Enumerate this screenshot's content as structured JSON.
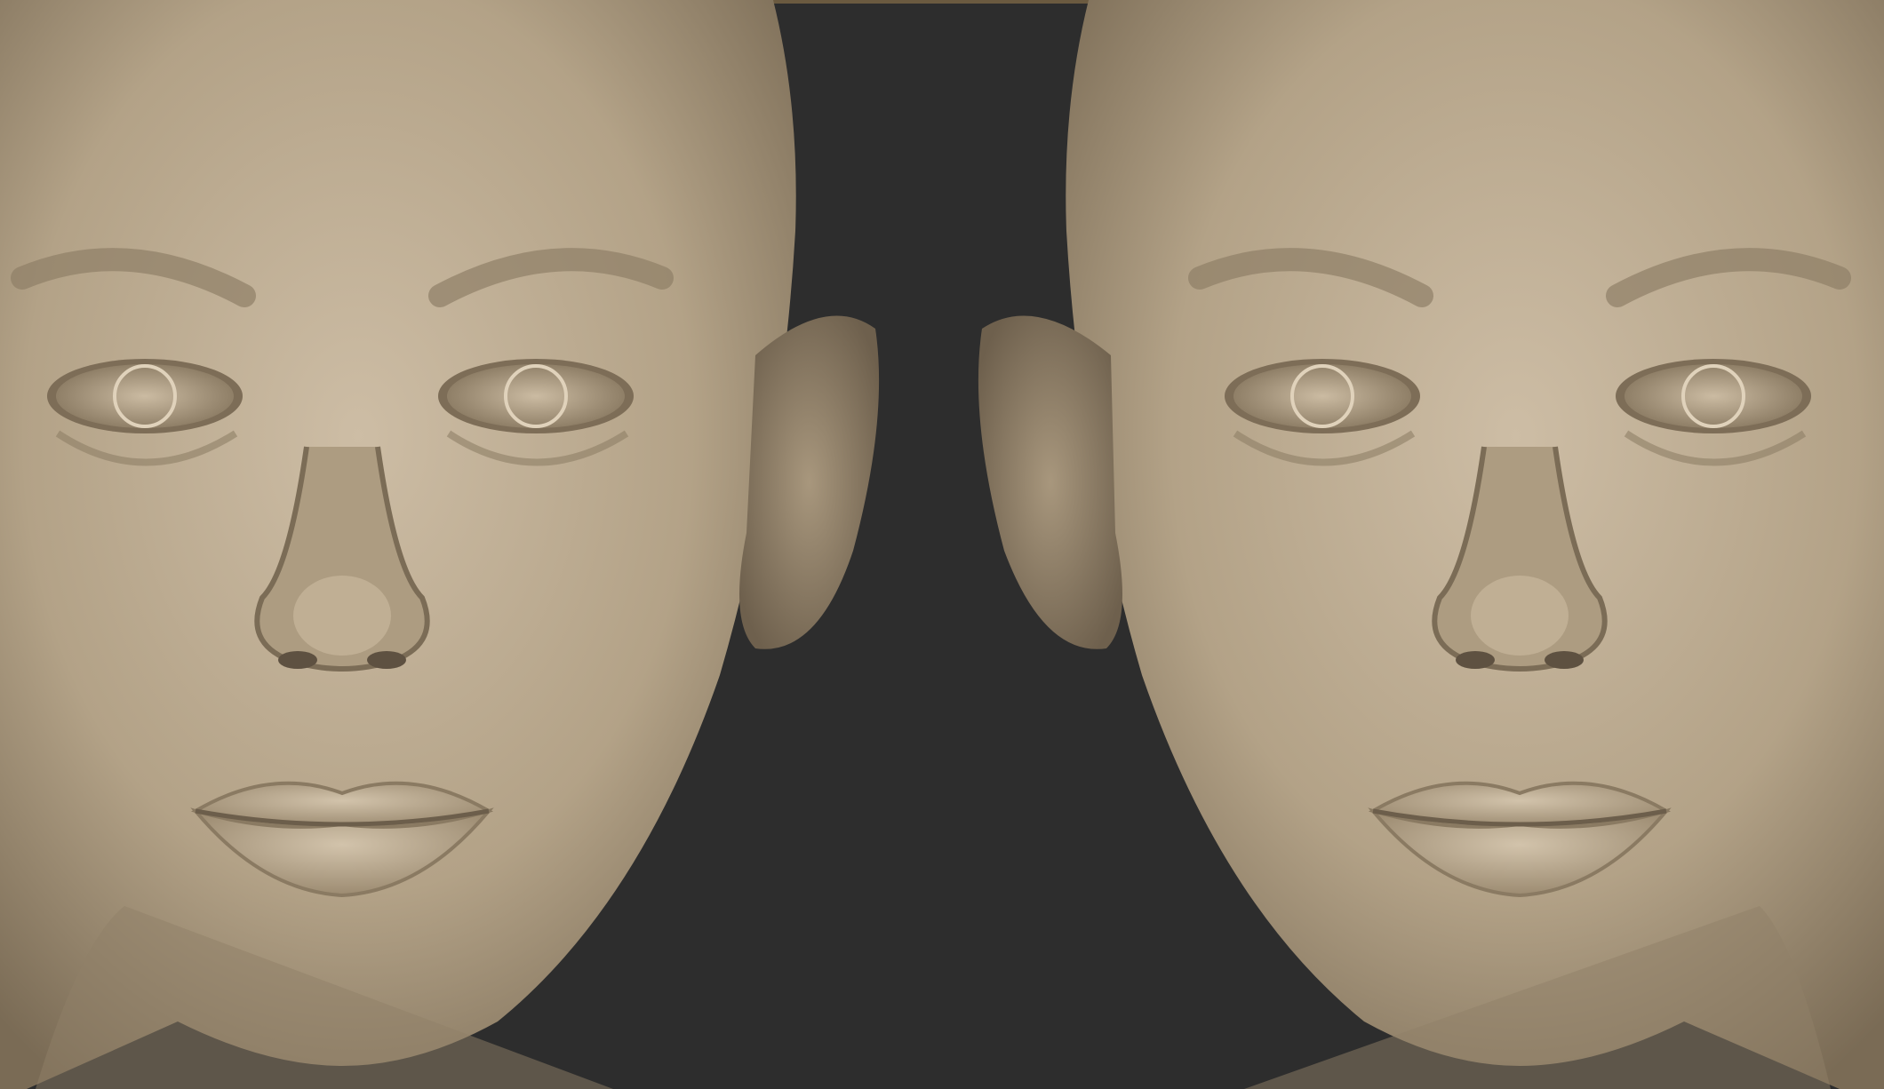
{
  "palette": {
    "background": "#2d2d2d",
    "skin_light": "#c9b9a1",
    "skin_mid": "#a8977d",
    "skin_dark": "#6e604d",
    "top_edge": "#6b5a40"
  },
  "views": [
    {
      "label": "left",
      "ear_side": "right"
    },
    {
      "label": "right",
      "ear_side": "left"
    }
  ]
}
